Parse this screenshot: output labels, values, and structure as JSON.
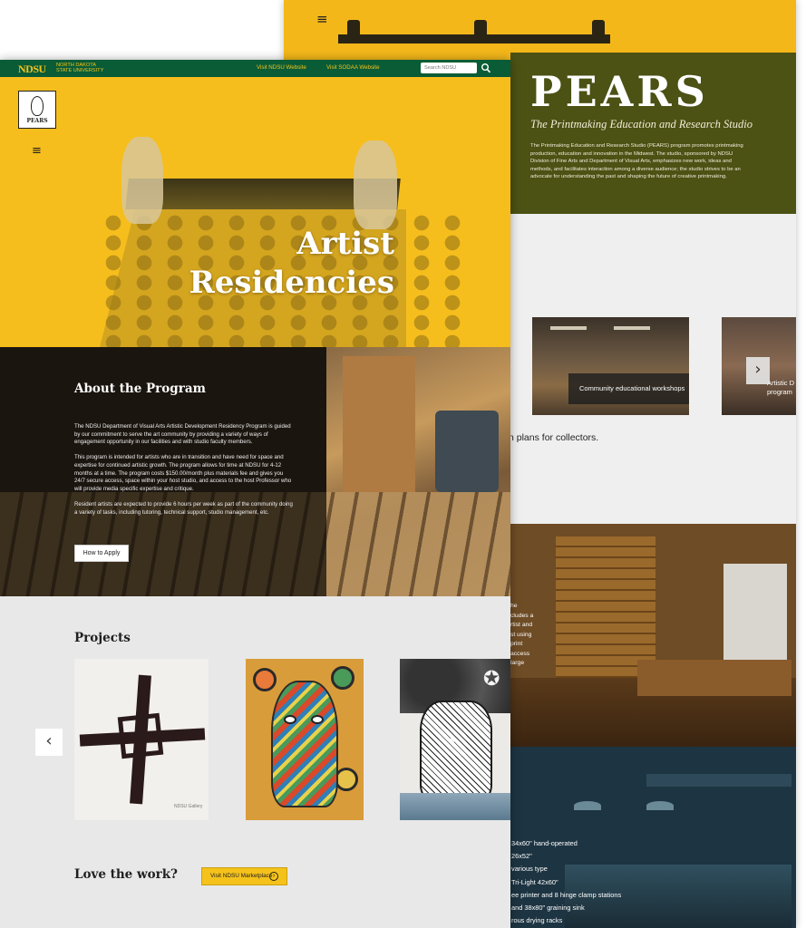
{
  "back_page": {
    "hamburger": "≡",
    "title": "PEARS",
    "subtitle": "The Printmaking Education and  Research Studio",
    "description": "The Printmaking Education and Research Studio (PEARS) program promotes printmaking production, education and innovation in the Midwest. The studio, sponsored by NDSU Division of Fine Arts and Department of Visual Arts, emphasizes new work, ideas and methods, and facilitates interaction among a diverse audience; the studio strives to be an advocate for understanding the past and shaping the future of creative printmaking.",
    "cards": [
      {
        "caption": "Community educational workshops"
      },
      {
        "caption": "Artistic D\nprogram"
      }
    ],
    "next_arrow": "›",
    "collectors_text": "n plans for collectors.",
    "studio_fragments": [
      "he",
      "cludes a",
      "rtist and",
      "st using",
      "print",
      "access",
      "large"
    ],
    "equipment": [
      "34x60\" hand-operated",
      "26x52\"",
      "various type",
      "Tri-Light 42x60\"",
      "ee printer and 8 hinge clamp stations",
      "and 38x80\"  graining sink",
      "rous drying racks"
    ]
  },
  "topbar": {
    "logo": "NDSU",
    "logo_small": "NORTH DAKOTA STATE UNIVERSITY",
    "links": [
      "Visit NDSU Website",
      "Visit SODAA Website"
    ],
    "search_placeholder": "Search NDSU",
    "search_icon": "search-icon"
  },
  "hero": {
    "badge_label": "PEARS",
    "hamburger": "≡",
    "title_line1": "Artist",
    "title_line2": "Residencies"
  },
  "about": {
    "title": "About the Program",
    "paragraphs": [
      "The NDSU Department of Visual Arts Artistic Development Residency Program is guided by our commitment to serve the art community by providing a variety of ways of engagement opportunity in our facilities and with studio faculty members.",
      "This program is intended for artists who are in transition and have need for space and expertise for continued artistic growth. The program allows for time at NDSU for 4-12 months at a time. The program costs $150.00/month plus materials fee and gives you 24/7 secure access, space within your host studio, and access to the host Professor who will provide media specific expertise and critique.",
      "Resident artists are expected to provide 6 hours per week as part of the community doing a variety of tasks, including tutoring, technical support, studio management, etc."
    ],
    "apply_label": "How to Apply"
  },
  "projects": {
    "title": "Projects",
    "art_signature": "NDSU Gallery",
    "prev": "‹",
    "next": "›",
    "star": "✪"
  },
  "love": {
    "title": "Love the work?",
    "button_label": "Visit NDSU Marketplace",
    "button_icon": "arrow-circle-icon"
  },
  "colors": {
    "ndsu_green": "#0a5c36",
    "ndsu_yellow": "#f5c21b",
    "hero_yellow": "#f6be1d",
    "olive": "#3e4814"
  }
}
